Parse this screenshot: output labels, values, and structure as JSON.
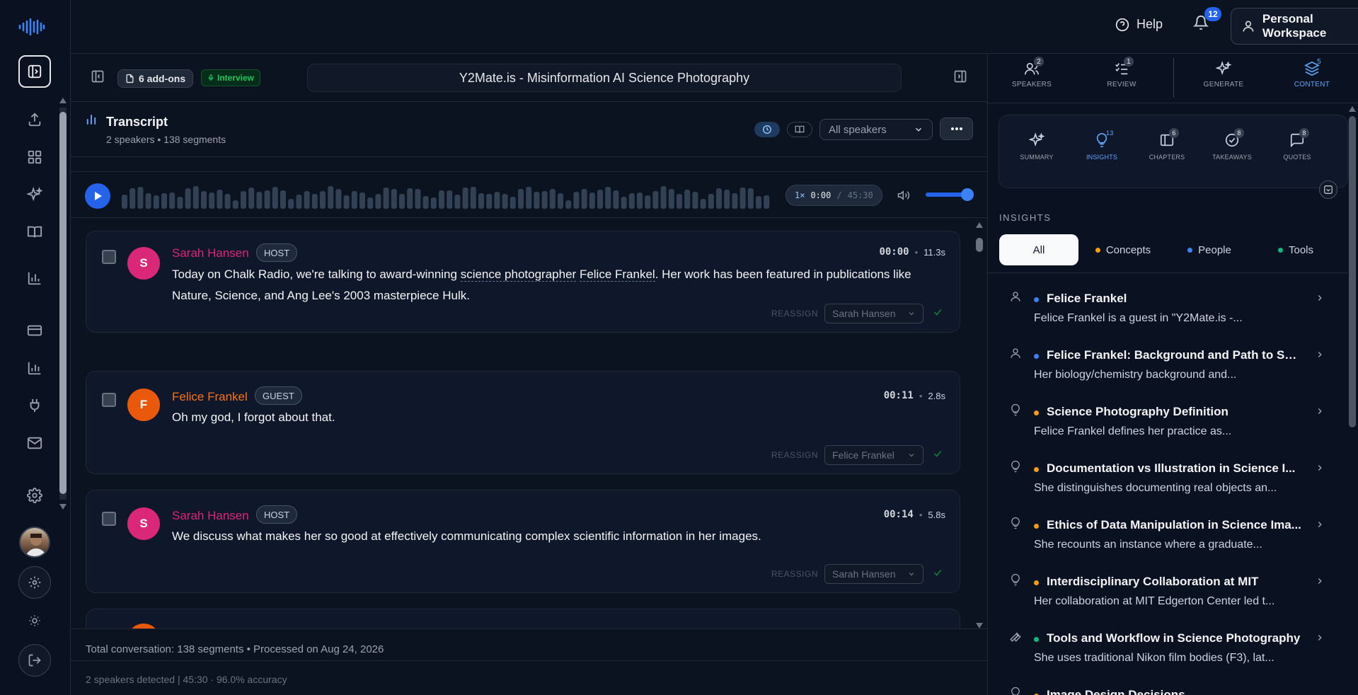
{
  "topbar": {
    "help_label": "Help",
    "notifications_count": "12",
    "workspace_label": "Personal Workspace"
  },
  "doc": {
    "addons_label": "6 add-ons",
    "mode_label": "Interview",
    "title": "Y2Mate.is - Misinformation AI Science Photography"
  },
  "transcript": {
    "title": "Transcript",
    "subtitle": "2 speakers • 138 segments",
    "speaker_filter": "All speakers"
  },
  "player": {
    "speed": "1×",
    "current": "0:00",
    "sep": "/",
    "duration": "45:30",
    "volume_pct": 100
  },
  "segments": [
    {
      "initial": "S",
      "speaker": "Sarah Hansen",
      "role": "HOST",
      "time": "00:00",
      "duration": "11.3s",
      "text_parts": [
        "Today on Chalk Radio, we're talking to award-winning ",
        "science photographer",
        " ",
        "Felice Frankel",
        ". Her work has been featured in publications like Nature, Science, and Ang Lee's 2003 masterpiece Hulk."
      ],
      "reassign_label": "REASSIGN",
      "reassign_value": "Sarah Hansen",
      "color": "#db2777"
    },
    {
      "initial": "F",
      "speaker": "Felice Frankel",
      "role": "GUEST",
      "time": "00:11",
      "duration": "2.8s",
      "text": "Oh my god, I forgot about that.",
      "reassign_label": "REASSIGN",
      "reassign_value": "Felice Frankel",
      "color": "#ea580c"
    },
    {
      "initial": "S",
      "speaker": "Sarah Hansen",
      "role": "HOST",
      "time": "00:14",
      "duration": "5.8s",
      "text": "We discuss what makes her so good at effectively communicating complex scientific information in her images.",
      "reassign_label": "REASSIGN",
      "reassign_value": "Sarah Hansen",
      "color": "#db2777"
    }
  ],
  "footer": {
    "line1": "Total conversation: 138 segments • Processed on Aug 24, 2026",
    "line2": "2 speakers detected | 45:30 · 96.0% accuracy"
  },
  "right_tabs": [
    {
      "label": "SPEAKERS",
      "badge": "2",
      "icon": "users-icon"
    },
    {
      "label": "REVIEW",
      "badge": "1",
      "icon": "checklist-icon"
    },
    {
      "label": "GENERATE",
      "badge": "",
      "icon": "sparkles-icon"
    },
    {
      "label": "CONTENT",
      "badge": "5",
      "icon": "layers-icon"
    }
  ],
  "sub_tabs": [
    {
      "label": "SUMMARY",
      "badge": "",
      "icon": "sparkles-icon"
    },
    {
      "label": "INSIGHTS",
      "badge": "13",
      "icon": "lightbulb-icon"
    },
    {
      "label": "CHAPTERS",
      "badge": "6",
      "icon": "bookmark-icon"
    },
    {
      "label": "TAKEAWAYS",
      "badge": "8",
      "icon": "check-circle-icon"
    },
    {
      "label": "QUOTES",
      "badge": "8",
      "icon": "message-icon"
    }
  ],
  "insights_label": "INSIGHTS",
  "filters": [
    {
      "label": "All",
      "color": ""
    },
    {
      "label": "Concepts",
      "color": "#f59e0b"
    },
    {
      "label": "People",
      "color": "#3b82f6"
    },
    {
      "label": "Tools",
      "color": "#10b981"
    }
  ],
  "insights": [
    {
      "title": "Felice Frankel",
      "desc": "Felice Frankel is a guest in \"Y2Mate.is -...",
      "type": "person",
      "color": "#3b82f6"
    },
    {
      "title": "Felice Frankel: Background and Path to Sci...",
      "desc": "Her biology/chemistry background and...",
      "type": "person",
      "color": "#3b82f6"
    },
    {
      "title": "Science Photography Definition",
      "desc": "Felice Frankel defines her practice as...",
      "type": "concept",
      "color": "#f59e0b"
    },
    {
      "title": "Documentation vs Illustration in Science I...",
      "desc": "She distinguishes documenting real objects an...",
      "type": "concept",
      "color": "#f59e0b"
    },
    {
      "title": "Ethics of Data Manipulation in Science Ima...",
      "desc": "She recounts an instance where a graduate...",
      "type": "concept",
      "color": "#f59e0b"
    },
    {
      "title": "Interdisciplinary Collaboration at MIT",
      "desc": "Her collaboration at MIT Edgerton Center led t...",
      "type": "concept",
      "color": "#f59e0b"
    },
    {
      "title": "Tools and Workflow in Science Photography",
      "desc": "She uses traditional Nikon film bodies (F3), lat...",
      "type": "tool",
      "color": "#10b981"
    },
    {
      "title": "Image Design Decisions",
      "desc": "",
      "type": "concept",
      "color": "#f59e0b"
    }
  ]
}
